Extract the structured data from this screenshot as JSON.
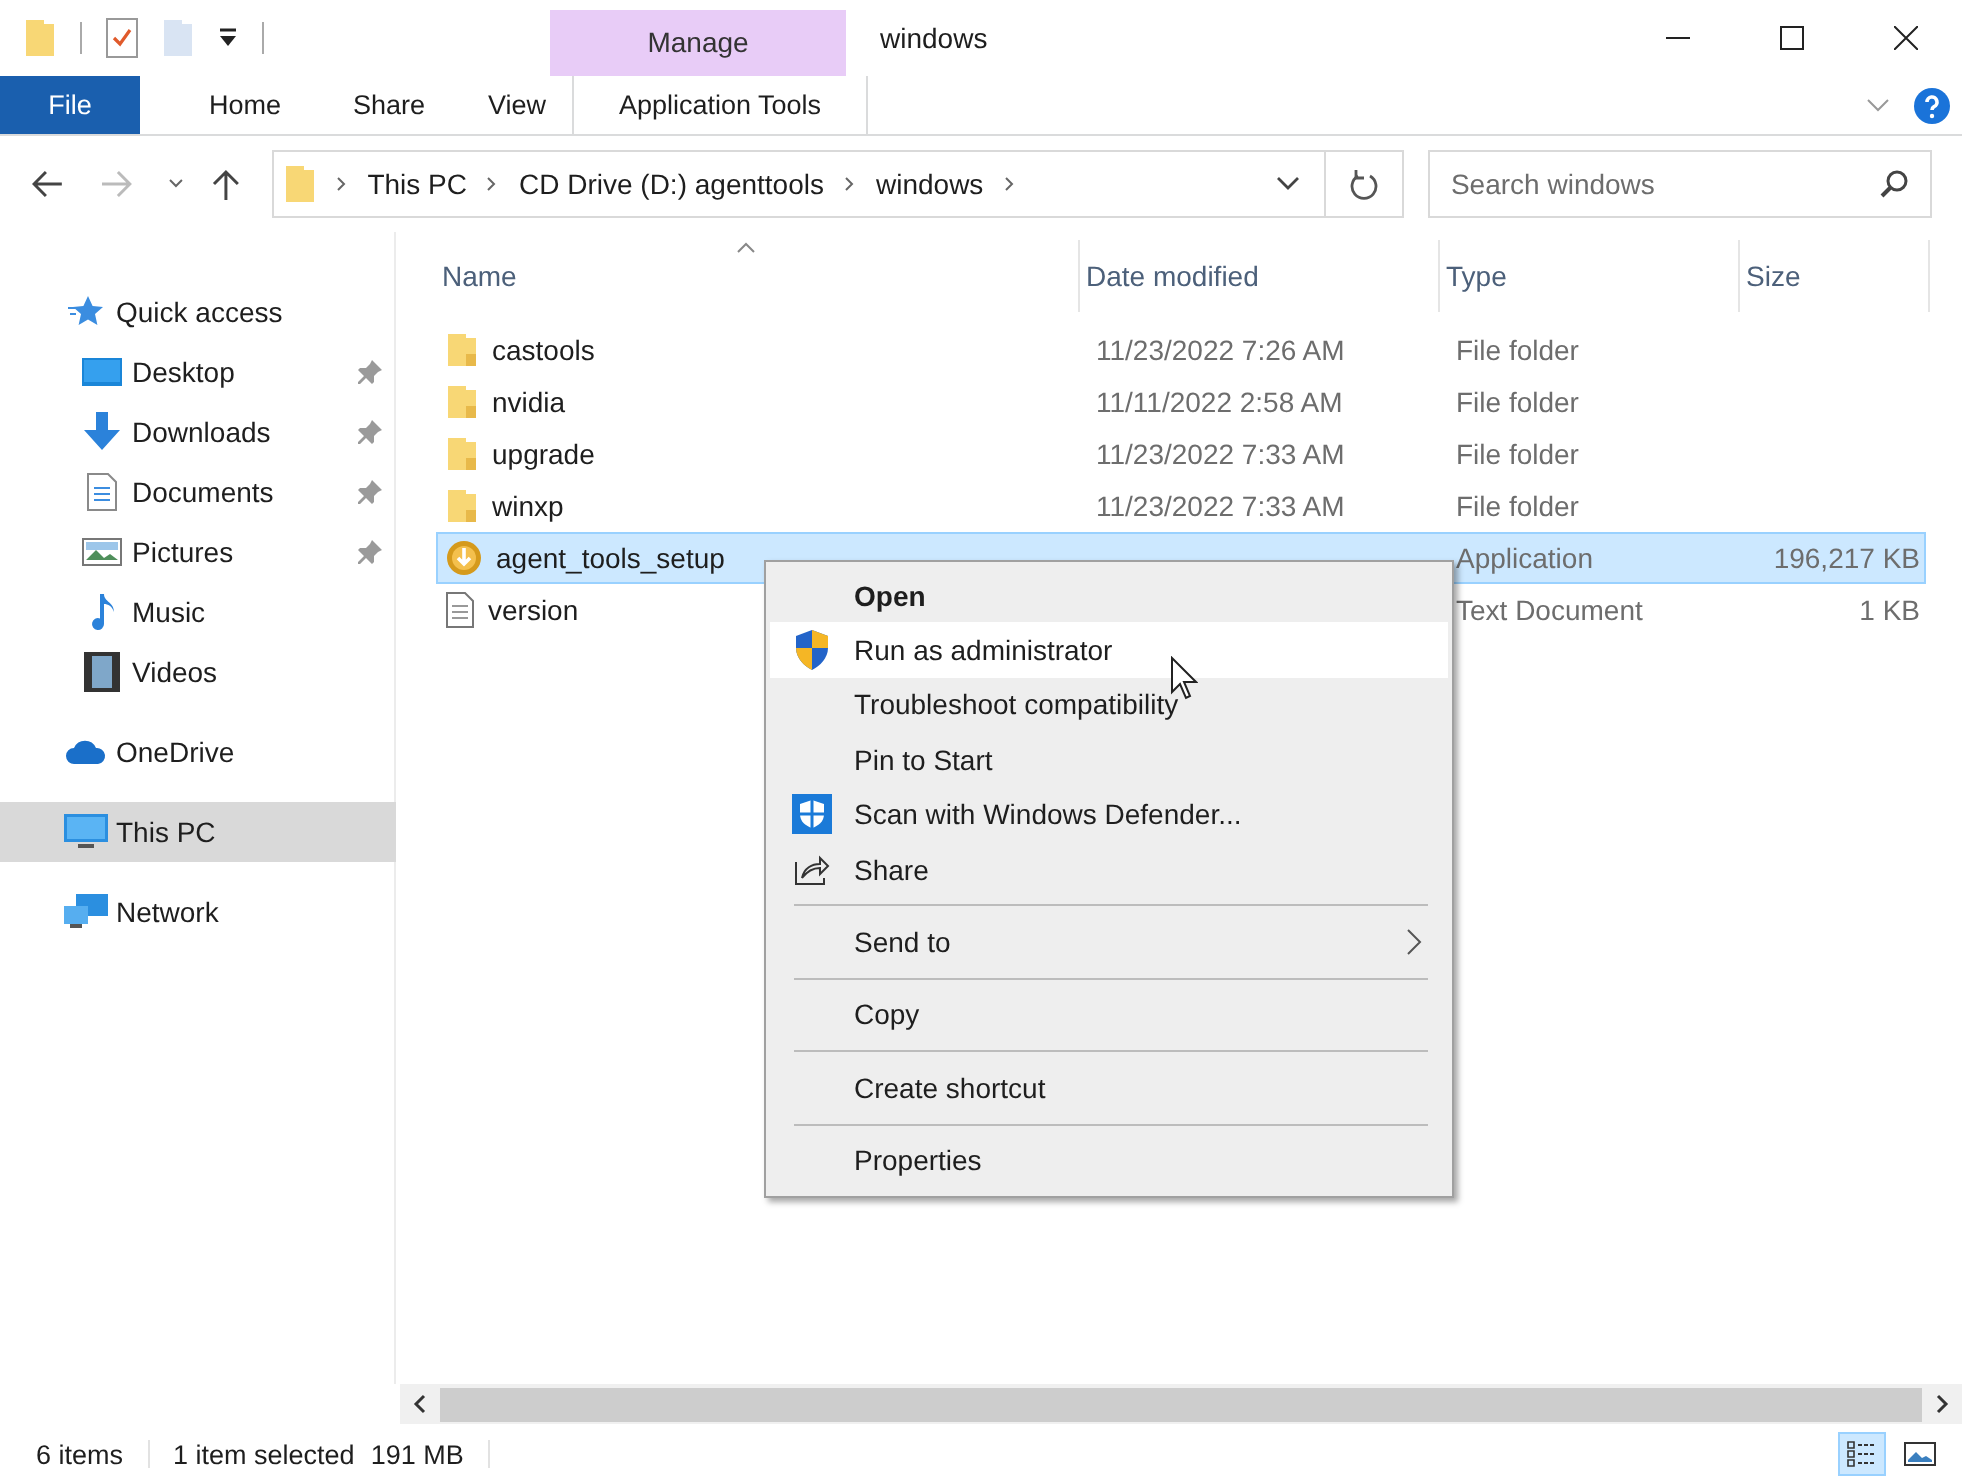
{
  "window": {
    "title": "windows"
  },
  "quick_toolbar": [
    {
      "kind": "folder"
    },
    {
      "kind": "properties"
    },
    {
      "kind": "newfolder"
    },
    {
      "kind": "customize"
    }
  ],
  "ribbon_tabs": [
    {
      "label": "File",
      "kind": "file",
      "selected": false
    },
    {
      "label": "Home",
      "kind": "tab",
      "selected": false
    },
    {
      "label": "Share",
      "kind": "tab",
      "selected": false
    },
    {
      "label": "View",
      "kind": "tab",
      "selected": false
    },
    {
      "label": "Application Tools",
      "kind": "contextual",
      "group": "Manage",
      "selected": false
    }
  ],
  "address_bar": {
    "breadcrumbs": [
      "This PC",
      "CD Drive (D:) agenttools",
      "windows"
    ]
  },
  "search": {
    "placeholder": "Search windows"
  },
  "sidebar": {
    "items": [
      {
        "label": "Quick access",
        "selected": false,
        "children": [
          {
            "label": "Desktop",
            "pinned": true,
            "selected": false
          },
          {
            "label": "Downloads",
            "pinned": true,
            "selected": false
          },
          {
            "label": "Documents",
            "pinned": true,
            "selected": false
          },
          {
            "label": "Pictures",
            "pinned": true,
            "selected": false
          },
          {
            "label": "Music",
            "pinned": false,
            "selected": false
          },
          {
            "label": "Videos",
            "pinned": false,
            "selected": false
          }
        ]
      },
      {
        "label": "OneDrive",
        "selected": false
      },
      {
        "label": "This PC",
        "selected": true
      },
      {
        "label": "Network",
        "selected": false
      }
    ]
  },
  "table": {
    "columns": [
      {
        "label": "Name",
        "sorted": true
      },
      {
        "label": "Date modified",
        "sorted": false
      },
      {
        "label": "Type",
        "sorted": false
      },
      {
        "label": "Size",
        "sorted": false
      }
    ],
    "rows": [
      {
        "name": "castools",
        "date": "11/23/2022 7:26 AM",
        "type": "File folder",
        "kind": "folder",
        "selected": false
      },
      {
        "name": "nvidia",
        "date": "11/11/2022 2:58 AM",
        "type": "File folder",
        "kind": "folder",
        "selected": false
      },
      {
        "name": "upgrade",
        "date": "11/23/2022 7:33 AM",
        "type": "File folder",
        "kind": "folder",
        "selected": false
      },
      {
        "name": "winxp",
        "date": "11/23/2022 7:33 AM",
        "type": "File folder",
        "kind": "folder",
        "selected": false
      },
      {
        "name": "agent_tools_setup",
        "type": "Application",
        "size": "196,217 KB",
        "kind": "app",
        "selected": true
      },
      {
        "name": "version",
        "type": "Text Document",
        "size": "1 KB",
        "kind": "text",
        "selected": false
      }
    ]
  },
  "context_menu": {
    "items": [
      {
        "kind": "item",
        "label": "Open",
        "default": true,
        "selected": false
      },
      {
        "kind": "elevated",
        "label": "Run as administrator",
        "default": false,
        "selected": true
      },
      {
        "kind": "item",
        "label": "Troubleshoot compatibility",
        "default": false,
        "selected": false
      },
      {
        "kind": "item",
        "label": "Pin to Start",
        "default": false,
        "selected": false
      },
      {
        "kind": "scan",
        "label": "Scan with Windows Defender...",
        "default": false,
        "selected": false
      },
      {
        "kind": "share",
        "label": "Share",
        "default": false,
        "selected": false
      },
      {
        "kind": "separator"
      },
      {
        "kind": "item",
        "label": "Send to",
        "submenu": true,
        "default": false,
        "selected": false
      },
      {
        "kind": "separator"
      },
      {
        "kind": "item",
        "label": "Copy",
        "default": false,
        "selected": false
      },
      {
        "kind": "separator"
      },
      {
        "kind": "item",
        "label": "Create shortcut",
        "default": false,
        "selected": false
      },
      {
        "kind": "separator"
      },
      {
        "kind": "item",
        "label": "Properties",
        "default": false,
        "selected": false
      }
    ]
  },
  "status_bar": {
    "items_count": "6 items",
    "selection": "1 item selected",
    "selection_size": "191 MB",
    "views": [
      {
        "kind": "details",
        "selected": true
      },
      {
        "kind": "large",
        "selected": false
      }
    ]
  }
}
